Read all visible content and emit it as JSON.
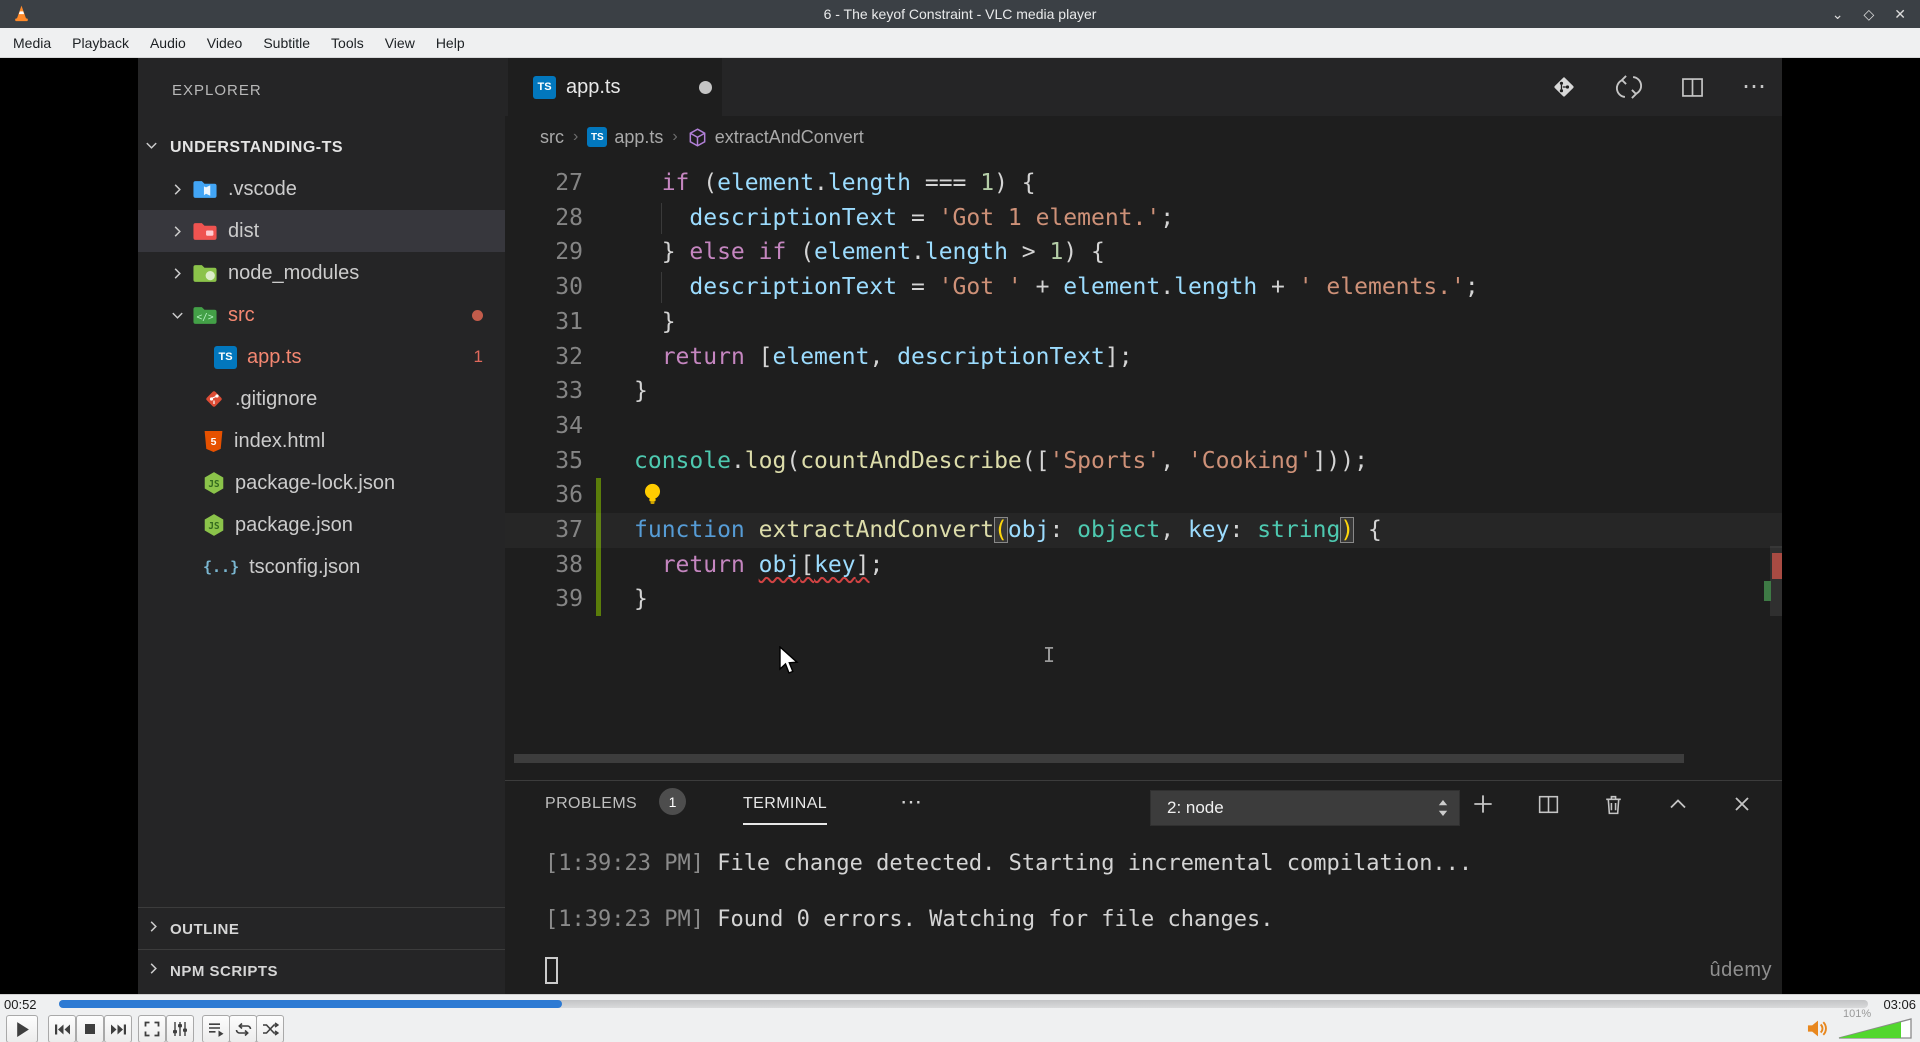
{
  "window": {
    "title": "6 - The keyof Constraint - VLC media player",
    "menu": [
      "Media",
      "Playback",
      "Audio",
      "Video",
      "Subtitle",
      "Tools",
      "View",
      "Help"
    ],
    "controls": {
      "minimize": "⌄",
      "maximize": "◇",
      "close": "✕"
    }
  },
  "sidebar": {
    "header": "EXPLORER",
    "project": "UNDERSTANDING-TS",
    "items": [
      {
        "label": ".vscode",
        "icon": "folder-vscode",
        "chevron": "right"
      },
      {
        "label": "dist",
        "icon": "folder-dist",
        "chevron": "right",
        "selected": true
      },
      {
        "label": "node_modules",
        "icon": "folder-node",
        "chevron": "right"
      },
      {
        "label": "src",
        "icon": "folder-src",
        "chevron": "down",
        "modified": true,
        "badge": "dot"
      },
      {
        "label": "app.ts",
        "icon": "file-ts",
        "indent": 1,
        "modified": true,
        "badge": "1"
      },
      {
        "label": ".gitignore",
        "icon": "file-git",
        "indent": 0.5
      },
      {
        "label": "index.html",
        "icon": "file-html",
        "indent": 0.5
      },
      {
        "label": "package-lock.json",
        "icon": "file-npm",
        "indent": 0.5
      },
      {
        "label": "package.json",
        "icon": "file-npm",
        "indent": 0.5
      },
      {
        "label": "tsconfig.json",
        "icon": "file-tsconfig",
        "indent": 0.5
      }
    ],
    "sections": [
      {
        "label": "OUTLINE"
      },
      {
        "label": "NPM SCRIPTS"
      }
    ]
  },
  "editor": {
    "tab": {
      "label": "app.ts",
      "icon": "ts",
      "dirty": true
    },
    "actions": [
      "open-changes",
      "compare-changes",
      "split-editor",
      "more-actions"
    ],
    "breadcrumb": {
      "items": [
        "src",
        "app.ts",
        "extractAndConvert"
      ],
      "separator": "›"
    },
    "code": {
      "lines": [
        {
          "n": 27,
          "g": false,
          "t": [
            [
              "pu",
              "  "
            ],
            [
              "kw",
              "if"
            ],
            [
              "pu",
              " ("
            ],
            [
              "id",
              "element"
            ],
            [
              "pu",
              "."
            ],
            [
              "id",
              "length"
            ],
            [
              "pu",
              " === "
            ],
            [
              "num",
              "1"
            ],
            [
              "pu",
              ") {"
            ]
          ]
        },
        {
          "n": 28,
          "g": true,
          "t": [
            [
              "pu",
              "    "
            ],
            [
              "id",
              "descriptionText"
            ],
            [
              "pu",
              " = "
            ],
            [
              "str",
              "'Got 1 element.'"
            ],
            [
              "pu",
              ";"
            ]
          ]
        },
        {
          "n": 29,
          "g": false,
          "t": [
            [
              "pu",
              "  } "
            ],
            [
              "kw",
              "else"
            ],
            [
              "pu",
              " "
            ],
            [
              "kw",
              "if"
            ],
            [
              "pu",
              " ("
            ],
            [
              "id",
              "element"
            ],
            [
              "pu",
              "."
            ],
            [
              "id",
              "length"
            ],
            [
              "pu",
              " > "
            ],
            [
              "num",
              "1"
            ],
            [
              "pu",
              ") {"
            ]
          ]
        },
        {
          "n": 30,
          "g": true,
          "t": [
            [
              "pu",
              "    "
            ],
            [
              "id",
              "descriptionText"
            ],
            [
              "pu",
              " = "
            ],
            [
              "str",
              "'Got '"
            ],
            [
              "pu",
              " + "
            ],
            [
              "id",
              "element"
            ],
            [
              "pu",
              "."
            ],
            [
              "id",
              "length"
            ],
            [
              "pu",
              " + "
            ],
            [
              "str",
              "' elements.'"
            ],
            [
              "pu",
              ";"
            ]
          ]
        },
        {
          "n": 31,
          "g": false,
          "t": [
            [
              "pu",
              "  }"
            ]
          ]
        },
        {
          "n": 32,
          "g": false,
          "t": [
            [
              "pu",
              "  "
            ],
            [
              "kw",
              "return"
            ],
            [
              "pu",
              " ["
            ],
            [
              "id",
              "element"
            ],
            [
              "pu",
              ", "
            ],
            [
              "id",
              "descriptionText"
            ],
            [
              "pu",
              "];"
            ]
          ]
        },
        {
          "n": 33,
          "g": false,
          "t": [
            [
              "pu",
              "}"
            ]
          ]
        },
        {
          "n": 34,
          "g": false,
          "t": []
        },
        {
          "n": 35,
          "g": false,
          "t": [
            [
              "ty",
              "console"
            ],
            [
              "pu",
              "."
            ],
            [
              "fn",
              "log"
            ],
            [
              "pu",
              "("
            ],
            [
              "fn",
              "countAndDescribe"
            ],
            [
              "pu",
              "(["
            ],
            [
              "str",
              "'Sports'"
            ],
            [
              "pu",
              ", "
            ],
            [
              "str",
              "'Cooking'"
            ],
            [
              "pu",
              "]));"
            ]
          ]
        },
        {
          "n": 36,
          "g": false,
          "bulb": true,
          "t": []
        },
        {
          "n": 37,
          "g": false,
          "cur": true,
          "t": [
            [
              "kd",
              "function"
            ],
            [
              "pu",
              " "
            ],
            [
              "fn",
              "extractAndConvert"
            ],
            [
              "gd",
              "("
            ],
            [
              "id",
              "obj"
            ],
            [
              "pu",
              ": "
            ],
            [
              "ty",
              "object"
            ],
            [
              "pu",
              ", "
            ],
            [
              "id",
              "key"
            ],
            [
              "pu",
              ": "
            ],
            [
              "ty",
              "string"
            ],
            [
              "gd",
              ")"
            ],
            [
              "pu",
              " {"
            ]
          ]
        },
        {
          "n": 38,
          "g": false,
          "t": [
            [
              "pu",
              "  "
            ],
            [
              "kw",
              "return"
            ],
            [
              "pu",
              " "
            ],
            [
              "id sq",
              "obj"
            ],
            [
              "pu sq",
              "["
            ],
            [
              "id sq",
              "key"
            ],
            [
              "pu sq",
              "]"
            ],
            [
              "pu",
              ";"
            ]
          ]
        },
        {
          "n": 39,
          "g": false,
          "t": [
            [
              "pu",
              "}"
            ]
          ]
        }
      ]
    }
  },
  "panel": {
    "tabs": [
      {
        "label": "PROBLEMS",
        "badge": "1"
      },
      {
        "label": "TERMINAL",
        "active": true
      }
    ],
    "more": "⋯",
    "dropdown": {
      "value": "2: node"
    },
    "actions": [
      "new-terminal",
      "split-terminal",
      "kill-terminal",
      "maximize-panel",
      "close-panel"
    ],
    "terminal": [
      {
        "time": "[1:39:23 PM]",
        "text": " File change detected. Starting incremental compilation..."
      },
      {
        "time": "[1:39:23 PM]",
        "text": " Found 0 errors. Watching for file changes."
      }
    ],
    "watermark": "ûdemy"
  },
  "player": {
    "elapsed": "00:52",
    "duration": "03:06",
    "progress_pct": 27.8,
    "buttons": [
      "play",
      "previous",
      "stop",
      "next",
      "fullscreen",
      "extended-settings",
      "playlist",
      "loop",
      "random"
    ],
    "volume_label": "101%",
    "volume_pct": 85
  },
  "colors": {
    "accent_blue": "#2d7ad3",
    "error_red": "#f48771",
    "modified_green": "#5a7d0a"
  }
}
